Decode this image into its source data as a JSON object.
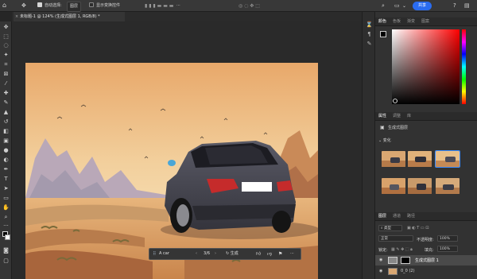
{
  "options_bar": {
    "auto_select_label": "自动选择:",
    "auto_select_value": "图层",
    "transform_label": "显示变换控件",
    "more_label": "···",
    "share_label": "共享"
  },
  "document": {
    "tab_title": "未标题-1 @ 124% (生成式图层 1, RGB/8) *"
  },
  "generative_bar": {
    "prompt": "A car",
    "counter": "3/6",
    "generate_label": "生成"
  },
  "color_panel": {
    "tabs": [
      "颜色",
      "色板",
      "渐变",
      "图案"
    ]
  },
  "properties_panel": {
    "tabs": [
      "属性",
      "调整",
      "库"
    ],
    "layer_type": "生成式图层",
    "variations_label": "变化",
    "variation_count": 6,
    "selected_variation": 3
  },
  "layers_panel": {
    "tabs": [
      "图层",
      "通道",
      "路径"
    ],
    "kind_label": "类型",
    "blend_mode": "正常",
    "opacity_label": "不透明度:",
    "opacity_value": "100%",
    "lock_label": "锁定:",
    "fill_label": "填充:",
    "fill_value": "100%",
    "layers": [
      {
        "name": "生成式图层 1",
        "selected": true
      },
      {
        "name": "0_0 (2)",
        "selected": false
      }
    ]
  },
  "colors": {
    "accent": "#2a6cf0",
    "selection": "#3a8cff",
    "picker_hue": "#ff0000"
  }
}
